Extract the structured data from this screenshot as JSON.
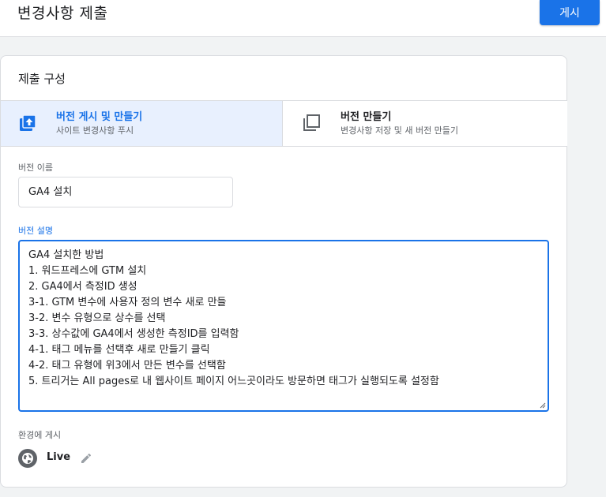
{
  "header": {
    "title": "변경사항 제출",
    "publish_label": "게시"
  },
  "card": {
    "title": "제출 구성",
    "options": [
      {
        "title": "버전 게시 및 만들기",
        "subtitle": "사이트 변경사항 푸시",
        "icon": "publish-version-icon",
        "selected": true
      },
      {
        "title": "버전 만들기",
        "subtitle": "변경사항 저장 및 새 버전 만들기",
        "icon": "copy-version-icon",
        "selected": false
      }
    ]
  },
  "version_name": {
    "label": "버전 이름",
    "value": "GA4 설치"
  },
  "version_description": {
    "label": "버전 설명",
    "lines": [
      "GA4 설치한 방법",
      "1. 워드프레스에 GTM 설치",
      "2. GA4에서 측정ID 생성",
      "3-1. GTM 변수에 사용자 정의 변수 새로 만들",
      "3-2. 변수 유형으로 상수를 선택",
      "3-3. 상수값에 GA4에서 생성한 측정ID를 입력함",
      "4-1. 태그 메뉴를 선택후 새로 만들기 클릭",
      "4-2. 태그 유형에 위3에서 만든 변수를 선택함",
      "5. 트리거는 All pages로 내 웹사이트 페이지 어느곳이라도 방문하면 태그가 실행되도록 설정함"
    ]
  },
  "environment": {
    "label": "환경에 게시",
    "name": "Live",
    "icon": "globe-icon"
  },
  "colors": {
    "accent": "#1a73e8",
    "selected_bg": "#e8f0fe",
    "background": "#f1f3f4"
  }
}
